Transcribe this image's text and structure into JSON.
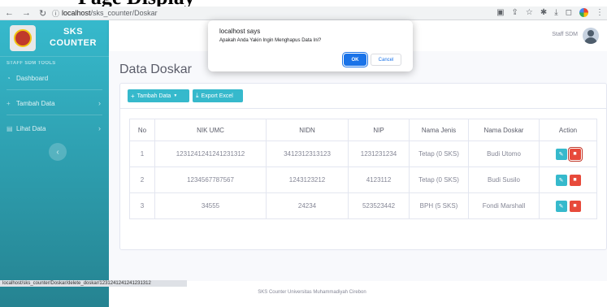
{
  "page_heading": "Page Display",
  "browser": {
    "url_host": "localhost",
    "url_path": "/sks_counter/Doskar"
  },
  "sidebar": {
    "brand_line1": "SKS",
    "brand_line2": "COUNTER",
    "heading": "STAFF SDM TOOLS",
    "items": [
      {
        "label": "Dashboard",
        "icon": "dashboard-icon"
      },
      {
        "label": "Tambah Data",
        "icon": "plus-icon"
      },
      {
        "label": "Lihat Data",
        "icon": "file-icon"
      }
    ]
  },
  "topbar": {
    "user_name": "Staff SDM"
  },
  "main": {
    "title": "Data Doskar",
    "buttons": {
      "tambah": "Tambah Data",
      "export": "Export Excel"
    },
    "table": {
      "headers": [
        "No",
        "NIK UMC",
        "NIDN",
        "NIP",
        "Nama Jenis",
        "Nama Doskar",
        "Action"
      ],
      "rows": [
        [
          "1",
          "1231241241241231312",
          "3412312313123",
          "1231231234",
          "Tetap (0 SKS)",
          "Budi Utomo"
        ],
        [
          "2",
          "1234567787567",
          "1243123212",
          "4123112",
          "Tetap (0 SKS)",
          "Budi Susilo"
        ],
        [
          "3",
          "34555",
          "24234",
          "523523442",
          "BPH (5 SKS)",
          "Fondi Marshall"
        ]
      ]
    }
  },
  "footer": "SKS Counter Universitas Muhammadiyah Cirebon",
  "status_url": "localhost/sks_counter/Doskar/delete_doskar/1231241241241231312",
  "dialog": {
    "title": "localhost says",
    "message": "Apakah Anda Yakin Ingin Menghapus Data Ini?",
    "ok": "OK",
    "cancel": "Cancel"
  },
  "colors": {
    "sidebar": "#36b9cc",
    "danger": "#e74a3b",
    "info": "#36b9cc",
    "dialog_primary": "#1a73e8"
  }
}
